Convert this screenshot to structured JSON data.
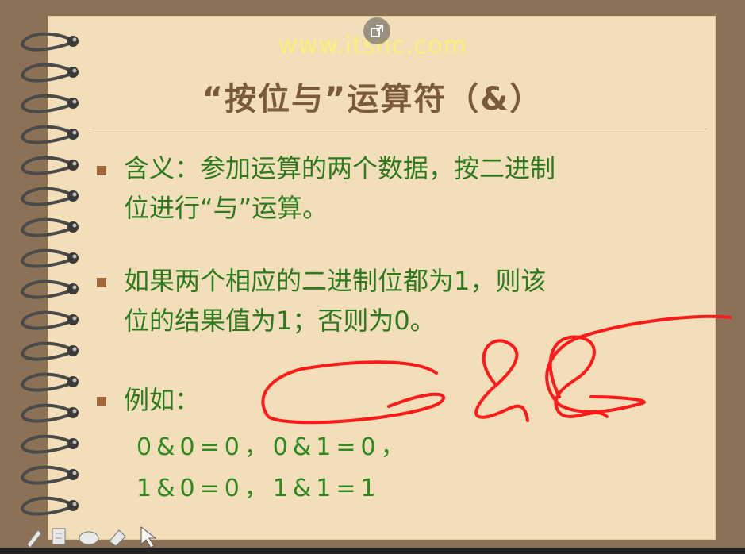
{
  "watermark": "www.itshc.com",
  "slide": {
    "title": "“按位与”运算符（&）",
    "bullets": [
      {
        "line1": "含义：参加运算的两个数据，按二进制",
        "line2": "位进行“与”运算。"
      },
      {
        "line1": "如果两个相应的二进制位都为1，则该",
        "line2": "位的结果值为1；否则为0。"
      },
      {
        "line1": "例如："
      }
    ],
    "examples": [
      "0&0=0，0&1=0，",
      "1&0=0，1&1=1"
    ]
  },
  "annotation": {
    "text": "&&",
    "color": "#ff1a1a"
  },
  "colors": {
    "background": "#8b7257",
    "page": "#f2deb8",
    "title": "#7a5a3a",
    "text": "#2d7a1e",
    "bullet": "#a0673a"
  },
  "icons": [
    "popout-icon",
    "pen-tool-icon",
    "note-icon",
    "eraser-icon",
    "highlighter-icon",
    "pointer-icon"
  ]
}
